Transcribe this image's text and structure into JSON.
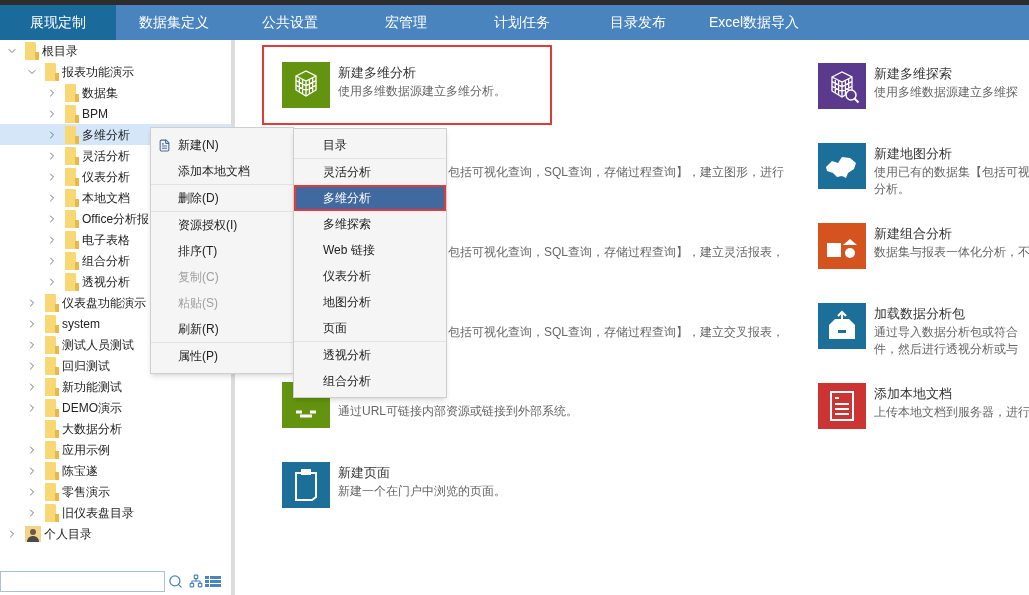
{
  "nav": {
    "tabs": [
      {
        "label": "展现定制",
        "selected": true
      },
      {
        "label": "数据集定义",
        "selected": false
      },
      {
        "label": "公共设置",
        "selected": false
      },
      {
        "label": "宏管理",
        "selected": false
      },
      {
        "label": "计划任务",
        "selected": false
      },
      {
        "label": "目录发布",
        "selected": false
      },
      {
        "label": "Excel数据导入",
        "selected": false
      }
    ]
  },
  "tree": {
    "items": [
      {
        "label": "根目录",
        "kind": "folder",
        "expanded": true,
        "selected": false,
        "children": [
          {
            "label": "报表功能演示",
            "kind": "folder",
            "expanded": true,
            "selected": false,
            "children": [
              {
                "label": "数据集",
                "kind": "folder",
                "expanded": false,
                "selected": false
              },
              {
                "label": "BPM",
                "kind": "folder",
                "expanded": false,
                "selected": false
              },
              {
                "label": "多维分析",
                "kind": "folder",
                "expanded": false,
                "selected": true
              },
              {
                "label": "灵活分析",
                "kind": "folder",
                "expanded": false,
                "selected": false
              },
              {
                "label": "仪表分析",
                "kind": "folder",
                "expanded": false,
                "selected": false
              },
              {
                "label": "本地文档",
                "kind": "folder",
                "expanded": false,
                "selected": false
              },
              {
                "label": "Office分析报",
                "kind": "folder",
                "expanded": false,
                "selected": false
              },
              {
                "label": "电子表格",
                "kind": "folder",
                "expanded": false,
                "selected": false
              },
              {
                "label": "组合分析",
                "kind": "folder",
                "expanded": false,
                "selected": false
              },
              {
                "label": "透视分析",
                "kind": "folder",
                "expanded": false,
                "selected": false
              }
            ]
          },
          {
            "label": "仪表盘功能演示",
            "kind": "folder",
            "expanded": false,
            "selected": false
          },
          {
            "label": "system",
            "kind": "folder",
            "expanded": false,
            "selected": false
          },
          {
            "label": "测试人员测试",
            "kind": "folder",
            "expanded": false,
            "selected": false
          },
          {
            "label": "回归测试",
            "kind": "folder",
            "expanded": false,
            "selected": false
          },
          {
            "label": "新功能测试",
            "kind": "folder",
            "expanded": false,
            "selected": false
          },
          {
            "label": "DEMO演示",
            "kind": "folder",
            "expanded": false,
            "selected": false
          },
          {
            "label": "大数据分析",
            "kind": "empty",
            "expanded": false,
            "selected": false
          },
          {
            "label": "应用示例",
            "kind": "folder",
            "expanded": false,
            "selected": false
          },
          {
            "label": "陈宝遂",
            "kind": "folder",
            "expanded": false,
            "selected": false
          },
          {
            "label": "零售演示",
            "kind": "folder",
            "expanded": false,
            "selected": false
          },
          {
            "label": "旧仪表盘目录",
            "kind": "folder",
            "expanded": false,
            "selected": false
          }
        ]
      },
      {
        "label": "个人目录",
        "kind": "user",
        "expanded": false,
        "selected": false
      }
    ]
  },
  "cards_left": [
    {
      "kind": "cube",
      "color": "#64940f",
      "title": "新建多维分析",
      "desc": [
        "使用多维数据源建立多维分析。"
      ],
      "highlighted": true
    },
    {
      "kind": "partial",
      "desc": [
        "包括可视化查询，SQL查询，存储过程查询】，建立图形，进行"
      ]
    },
    {
      "kind": "partial",
      "desc": [
        "包括可视化查询，SQL查询，存储过程查询】，建立灵活报表，"
      ]
    },
    {
      "kind": "partial",
      "desc": [
        "包括可视化查询，SQL查询，存储过程查询】，建立交叉报表，"
      ]
    },
    {
      "kind": "link",
      "color": "#64940f",
      "desc": [
        "通过URL可链接内部资源或链接到外部系统。"
      ]
    },
    {
      "kind": "page",
      "color": "#1b6f98",
      "title": "新建页面",
      "desc": [
        "新建一个在门户中浏览的页面。"
      ]
    }
  ],
  "cards_right": [
    {
      "kind": "cube-search",
      "color": "#5b3a8e",
      "title": "新建多维探索",
      "desc": [
        "使用多维数据源建立多维探"
      ]
    },
    {
      "kind": "map",
      "color": "#1b6f98",
      "title": "新建地图分析",
      "desc": [
        "使用已有的数据集【包括可视",
        "分析。"
      ]
    },
    {
      "kind": "shapes",
      "color": "#d4531f",
      "title": "新建组合分析",
      "desc": [
        "数据集与报表一体化分析，不"
      ]
    },
    {
      "kind": "box",
      "color": "#1b6f98",
      "title": "加载数据分析包",
      "desc": [
        "通过导入数据分析包或符合",
        "件，然后进行透视分析或与"
      ]
    },
    {
      "kind": "document",
      "color": "#cc3333",
      "title": "添加本地文档",
      "desc": [
        "上传本地文档到服务器，进行"
      ]
    }
  ],
  "context_menu": {
    "groups": [
      [
        {
          "label": "新建(N)",
          "kind": "new",
          "disabled": false
        },
        {
          "label": "添加本地文档",
          "kind": "plain",
          "disabled": false
        }
      ],
      [
        {
          "label": "删除(D)",
          "kind": "plain",
          "disabled": false
        }
      ],
      [
        {
          "label": "资源授权(I)",
          "kind": "plain",
          "disabled": false
        },
        {
          "label": "排序(T)",
          "kind": "plain",
          "disabled": false
        },
        {
          "label": "复制(C)",
          "kind": "plain",
          "disabled": true
        },
        {
          "label": "粘贴(S)",
          "kind": "plain",
          "disabled": true
        },
        {
          "label": "刷新(R)",
          "kind": "plain",
          "disabled": false
        }
      ],
      [
        {
          "label": "属性(P)",
          "kind": "plain",
          "disabled": false
        }
      ]
    ]
  },
  "submenu": {
    "groups": [
      [
        {
          "label": "目录",
          "selected": false
        }
      ],
      [
        {
          "label": "灵活分析",
          "selected": false
        },
        {
          "label": "多维分析",
          "selected": true
        },
        {
          "label": "多维探索",
          "selected": false
        },
        {
          "label": "Web 链接",
          "selected": false
        },
        {
          "label": "仪表分析",
          "selected": false
        },
        {
          "label": "地图分析",
          "selected": false
        },
        {
          "label": "页面",
          "selected": false
        }
      ],
      [
        {
          "label": "透视分析",
          "selected": false
        },
        {
          "label": "组合分析",
          "selected": false
        }
      ]
    ]
  }
}
